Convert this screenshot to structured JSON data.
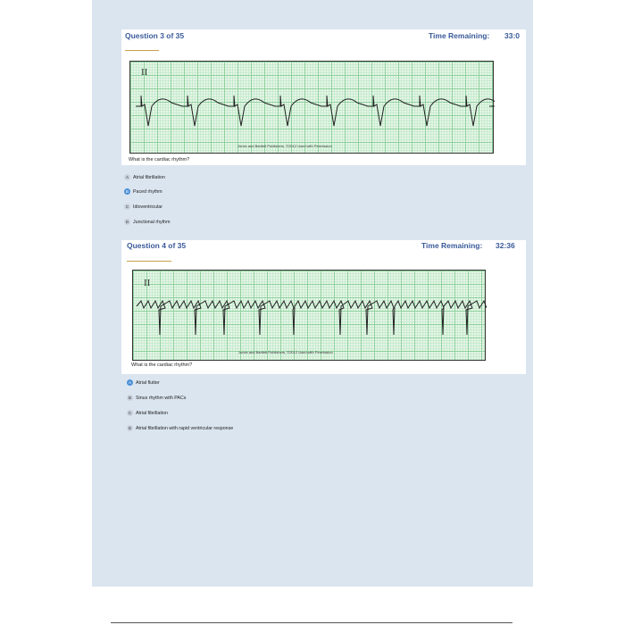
{
  "questions": [
    {
      "header": "Question 3 of 35",
      "time_label": "Time Remaining:",
      "time_value": "33:0",
      "lead": "II",
      "copyright": "Jones and Bartlett Publishers, ©2012 Used with Permission",
      "prompt": "What is the cardiac rhythm?",
      "options": [
        {
          "letter": "A",
          "label": "Atrial fibrillation",
          "selected": false
        },
        {
          "letter": "B",
          "label": "Paced rhythm",
          "selected": true
        },
        {
          "letter": "C",
          "label": "Idioventricular",
          "selected": false
        },
        {
          "letter": "D",
          "label": "Junctional rhythm",
          "selected": false
        }
      ]
    },
    {
      "header": "Question 4 of 35",
      "time_label": "Time Remaining:",
      "time_value": "32:36",
      "lead": "II",
      "copyright": "Jones and Bartlett Publishers, ©2012 Used with Permission",
      "prompt": "What is the cardiac rhythm?",
      "options": [
        {
          "letter": "A",
          "label": "Atrial flutter",
          "selected": true
        },
        {
          "letter": "B",
          "label": "Sinus rhythm with PACs",
          "selected": false
        },
        {
          "letter": "C",
          "label": "Atrial fibrillation",
          "selected": false
        },
        {
          "letter": "D",
          "label": "Atrial fibrillation with rapid ventricular response",
          "selected": false
        }
      ]
    }
  ],
  "colors": {
    "accent": "#3a5a9a",
    "selected": "#4a8fd8",
    "grid": "#8fd19e"
  }
}
